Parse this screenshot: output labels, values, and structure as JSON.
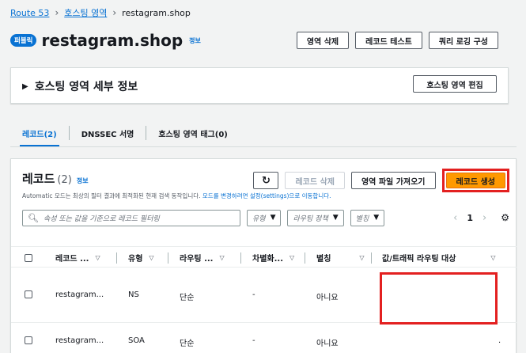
{
  "breadcrumb": {
    "items": [
      "Route 53",
      "호스팅 영역"
    ],
    "current": "restagram.shop",
    "separator": "›"
  },
  "header": {
    "badge": "퍼블릭",
    "title": "restagram.shop",
    "info": "정보",
    "buttons": [
      "영역 삭제",
      "레코드 테스트",
      "쿼리 로깅 구성"
    ]
  },
  "details_panel": {
    "label": "호스팅 영역 세부 정보",
    "edit_button": "호스팅 영역 편집"
  },
  "tabs": [
    "레코드(2)",
    "DNSSEC 서명",
    "호스팅 영역 태그(0)"
  ],
  "records": {
    "title": "레코드",
    "count": "(2)",
    "info": "정보",
    "desc_prefix": "Automatic 모드는 최상의 필터 결과에 최적화된 현재 검색 동작입니다. ",
    "desc_link": "모드를 변경하려면 설정(settings)으로 이동합니다.",
    "actions": {
      "refresh": "↻",
      "delete": "레코드 삭제",
      "import": "영역 파일 가져오기",
      "create": "레코드 생성"
    },
    "search_placeholder": "속성 또는 값을 기준으로 레코드 필터링",
    "filters": [
      "유형",
      "라우팅 정책",
      "별칭"
    ],
    "pager": {
      "prev": "‹",
      "page": "1",
      "next": "›",
      "settings": "⚙"
    },
    "columns": [
      "레코드 ...",
      "유형",
      "라우팅 ...",
      "차별화...",
      "별칭",
      "값/트래픽 라우팅 대상"
    ],
    "rows": [
      {
        "name": "restagram...",
        "type": "NS",
        "routing": "단순",
        "diff": "-",
        "alias": "아니요",
        "value": ""
      },
      {
        "name": "restagram...",
        "type": "SOA",
        "routing": "단순",
        "diff": "-",
        "alias": "아니요",
        "value": "."
      }
    ]
  },
  "colors": {
    "primary": "#ff9900",
    "link": "#0972d3",
    "highlight": "#e32020"
  }
}
